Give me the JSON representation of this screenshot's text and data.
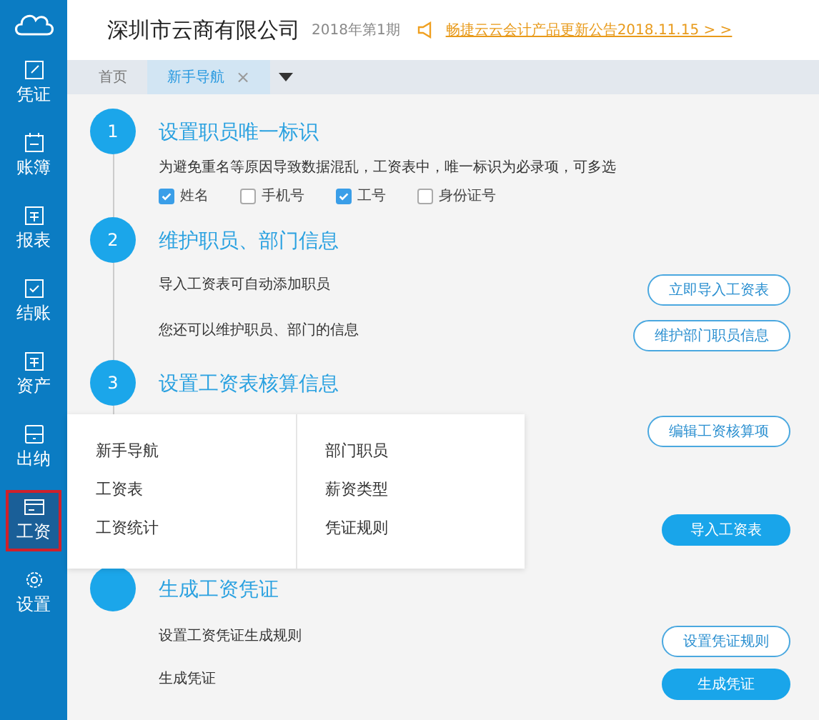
{
  "header": {
    "company": "深圳市云商有限公司",
    "period": "2018年第1期",
    "notice": "畅捷云云会计产品更新公告2018.11.15 > >"
  },
  "sidebar": {
    "items": [
      {
        "label": "凭证",
        "selected": false
      },
      {
        "label": "账簿",
        "selected": false
      },
      {
        "label": "报表",
        "selected": false
      },
      {
        "label": "结账",
        "selected": false
      },
      {
        "label": "资产",
        "selected": false
      },
      {
        "label": "出纳",
        "selected": false
      },
      {
        "label": "工资",
        "selected": true
      },
      {
        "label": "设置",
        "selected": false
      }
    ]
  },
  "tabs": [
    {
      "label": "首页",
      "selected": false,
      "closable": false
    },
    {
      "label": "新手导航",
      "selected": true,
      "closable": true,
      "close": "×"
    }
  ],
  "steps": [
    {
      "number": "1",
      "title": "设置职员唯一标识",
      "description": "为避免重名等原因导致数据混乱，工资表中，唯一标识为必录项，可多选",
      "options": [
        {
          "label": "姓名",
          "checked": true
        },
        {
          "label": "手机号",
          "checked": false
        },
        {
          "label": "工号",
          "checked": true
        },
        {
          "label": "身份证号",
          "checked": false
        }
      ]
    },
    {
      "number": "2",
      "title": "维护职员、部门信息",
      "rows": [
        {
          "text": "导入工资表可自动添加职员",
          "button": "立即导入工资表",
          "primary": false
        },
        {
          "text": "您还可以维护职员、部门的信息",
          "button": "维护部门职员信息",
          "primary": false
        }
      ]
    },
    {
      "number": "3",
      "title": "设置工资表核算信息",
      "rows": [
        {
          "button": "编辑工资核算项",
          "primary": false
        },
        {
          "button": "导入工资表",
          "primary": true
        }
      ]
    },
    {
      "title": "生成工资凭证",
      "rows": [
        {
          "text": "设置工资凭证生成规则",
          "button": "设置凭证规则",
          "primary": false
        },
        {
          "text": "生成凭证",
          "button": "生成凭证",
          "primary": true
        }
      ]
    }
  ],
  "popup_menu": {
    "columns": [
      [
        "新手导航",
        "工资表",
        "工资统计"
      ],
      [
        "部门职员",
        "薪资类型",
        "凭证规则"
      ]
    ]
  }
}
